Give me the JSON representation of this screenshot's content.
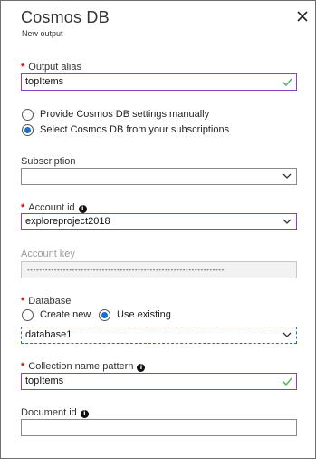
{
  "panel": {
    "title": "Cosmos DB",
    "subtitle": "New output"
  },
  "output_alias": {
    "label": "Output alias",
    "value": "topItems",
    "required": true,
    "valid": true
  },
  "settings_mode": {
    "options": [
      {
        "label": "Provide Cosmos DB settings manually",
        "selected": false
      },
      {
        "label": "Select Cosmos DB from your subscriptions",
        "selected": true
      }
    ]
  },
  "subscription": {
    "label": "Subscription",
    "value": ""
  },
  "account_id": {
    "label": "Account id",
    "value": "exploreproject2018",
    "required": true
  },
  "account_key": {
    "label": "Account key",
    "value": "••••••••••••••••••••••••••••••••••••••••••••••••••••••••••••••••••",
    "disabled": true
  },
  "database": {
    "label": "Database",
    "required": true,
    "options": [
      {
        "label": "Create new",
        "selected": false
      },
      {
        "label": "Use existing",
        "selected": true
      }
    ],
    "value": "database1"
  },
  "collection_name_pattern": {
    "label": "Collection name pattern",
    "value": "topItems",
    "required": true,
    "valid": true
  },
  "document_id": {
    "label": "Document id",
    "value": ""
  },
  "colors": {
    "required_star": "#e00000",
    "focus_border": "#8a3fbf",
    "radio_selected": "#1a6fd1",
    "valid_check": "#5cb85c"
  },
  "icons": {
    "close": "close-icon",
    "valid": "checkmark-icon",
    "dropdown": "chevron-down-icon",
    "info": "info-icon"
  }
}
